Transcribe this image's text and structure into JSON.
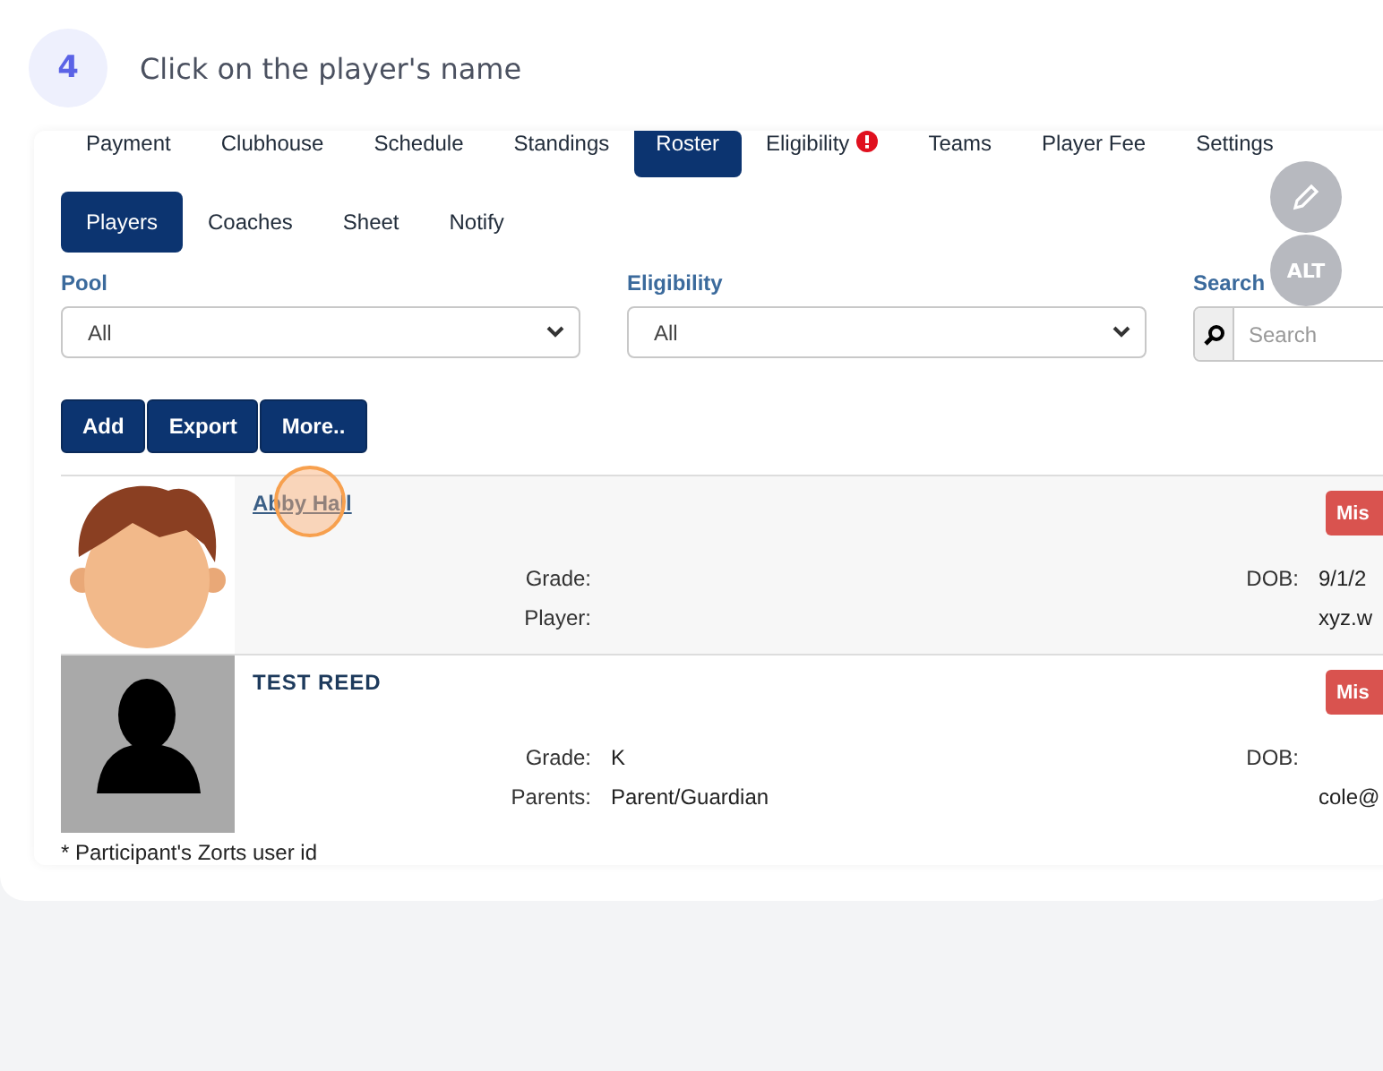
{
  "step": {
    "number": "4",
    "title": "Click on the player's name"
  },
  "tabs": [
    {
      "label": "Payment",
      "selected": false
    },
    {
      "label": "Clubhouse",
      "selected": false
    },
    {
      "label": "Schedule",
      "selected": false
    },
    {
      "label": "Standings",
      "selected": false
    },
    {
      "label": "Roster",
      "selected": true
    },
    {
      "label": "Eligibility",
      "selected": false,
      "alert": true
    },
    {
      "label": "Teams",
      "selected": false
    },
    {
      "label": "Player Fee",
      "selected": false
    },
    {
      "label": "Settings",
      "selected": false
    }
  ],
  "subtabs": [
    {
      "label": "Players",
      "selected": true
    },
    {
      "label": "Coaches",
      "selected": false
    },
    {
      "label": "Sheet",
      "selected": false
    },
    {
      "label": "Notify",
      "selected": false
    }
  ],
  "filters": [
    {
      "label": "Pool",
      "value": "All"
    },
    {
      "label": "Eligibility",
      "value": "All"
    }
  ],
  "search": {
    "label": "Search",
    "placeholder": "Search"
  },
  "actions": [
    "Add",
    "Export",
    "More.."
  ],
  "players": [
    {
      "name": "Abby Hall",
      "hovered": true,
      "avatar": {
        "kind": "cartoon"
      },
      "status": "Mis",
      "left_fields": [
        {
          "label": "Grade:"
        },
        {
          "label": "Player:"
        }
      ],
      "right_fields": [
        {
          "label": "DOB:",
          "value": "9/1/2"
        },
        {
          "value": "xyz.w"
        }
      ]
    },
    {
      "name": "TEST REED",
      "hovered": false,
      "avatar": {
        "kind": "silhouette"
      },
      "status": "Mis",
      "left_fields": [
        {
          "label": "Grade:",
          "value": "K"
        },
        {
          "label": "Parents:",
          "value": "Parent/Guardian"
        }
      ],
      "right_fields": [
        {
          "label": "DOB:"
        },
        {
          "value": "cole@"
        }
      ]
    }
  ],
  "footnote": "* Participant's Zorts user id",
  "floating": {
    "alt": "ALT"
  }
}
